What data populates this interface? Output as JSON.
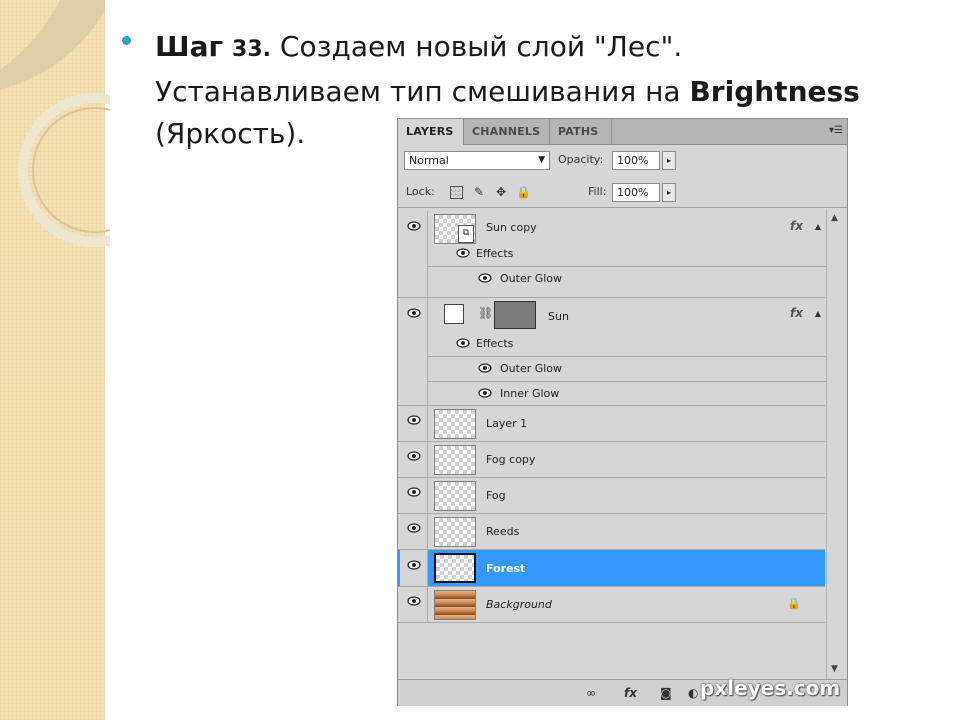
{
  "slide": {
    "step_word": "Шаг",
    "step_number": "33.",
    "line1": "Создаем новый слой \"Лес\".",
    "line2_prefix": "Устанавливаем тип смешивания на ",
    "line2_bold": "Brightness",
    "line3": "(Яркость)."
  },
  "panel": {
    "tabs": [
      {
        "label": "LAYERS",
        "active": true
      },
      {
        "label": "CHANNELS",
        "active": false
      },
      {
        "label": "PATHS",
        "active": false
      }
    ],
    "menu_icon": "panel-menu-icon",
    "blend_mode": "Normal",
    "opacity_label": "Opacity:",
    "opacity_value": "100%",
    "lock_label": "Lock:",
    "fill_label": "Fill:",
    "fill_value": "100%",
    "layers": [
      {
        "name": "Sun copy",
        "fx": "fx",
        "effects_label": "Effects",
        "effects": [
          "Outer Glow"
        ]
      },
      {
        "name": "Sun",
        "fx": "fx",
        "effects_label": "Effects",
        "effects": [
          "Outer Glow",
          "Inner Glow"
        ]
      },
      {
        "name": "Layer 1"
      },
      {
        "name": "Fog copy"
      },
      {
        "name": "Fog"
      },
      {
        "name": "Reeds"
      },
      {
        "name": "Forest",
        "selected": true
      },
      {
        "name": "Background",
        "locked": true
      }
    ],
    "bottom_icons": [
      "link-icon",
      "fx-icon",
      "mask-icon",
      "adjustment-icon",
      "folder-icon",
      "new-layer-icon",
      "trash-icon"
    ],
    "bottom_fx": "fx"
  },
  "watermark": "pxleyes.com",
  "colors": {
    "accent_bullet": "#2aa6c1",
    "selected_layer": "#3399ff",
    "panel_bg": "#d6d6d6"
  }
}
